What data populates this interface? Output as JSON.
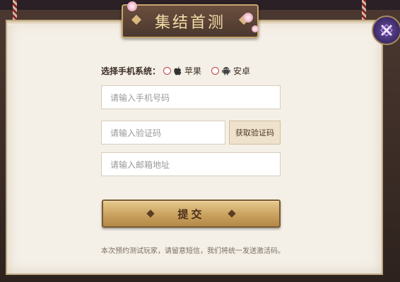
{
  "title": "集结首测",
  "form": {
    "os_label": "选择手机系统：",
    "os_options": [
      {
        "label": "苹果",
        "icon": "apple-icon"
      },
      {
        "label": "安卓",
        "icon": "android-icon"
      }
    ],
    "phone_placeholder": "请输入手机号码",
    "code_placeholder": "请输入验证码",
    "get_code_label": "获取验证码",
    "email_placeholder": "请输入邮箱地址",
    "submit_label": "提交"
  },
  "note": "本次预约测试玩家，请留意短信，我们将统一发送激活码。",
  "colors": {
    "panel": "#f5f0e7",
    "title_text": "#f2dca7",
    "submit_gold": "#caa15f",
    "radio_red": "#c04040",
    "close_purple": "#3b2a66"
  },
  "icons": [
    "close-icon"
  ]
}
